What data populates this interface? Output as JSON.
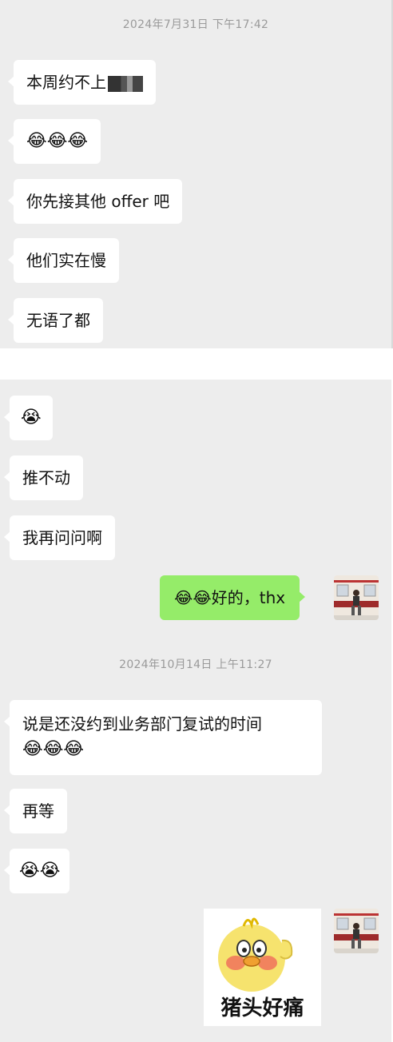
{
  "panel1": {
    "timestamp": "2024年7月31日 下午17:42",
    "messages": [
      {
        "text": "本周约不上"
      },
      {
        "text": "😂😂😂"
      },
      {
        "text": "你先接其他 offer 吧"
      },
      {
        "text": "他们实在慢"
      },
      {
        "text": "无语了都"
      }
    ]
  },
  "panel2": {
    "messages_before": [
      {
        "text": "😭"
      },
      {
        "text": "推不动"
      },
      {
        "text": "我再问问啊"
      }
    ],
    "my_reply": "😂😂好的，thx",
    "timestamp": "2024年10月14日 上午11:27",
    "messages_after": [
      {
        "line1": "说是还没约到业务部门复试的时间",
        "line2": "😂😂😂"
      },
      {
        "text": "再等"
      },
      {
        "text": "😭😭"
      }
    ],
    "sticker": {
      "caption": "猪头好痛"
    }
  },
  "colors": {
    "background": "#ededed",
    "incoming_bubble": "#ffffff",
    "outgoing_bubble": "#95ec69",
    "timestamp": "#9a9a9a"
  },
  "icons": {
    "avatar": "user-avatar-photo",
    "sticker": "duck-sticker"
  }
}
